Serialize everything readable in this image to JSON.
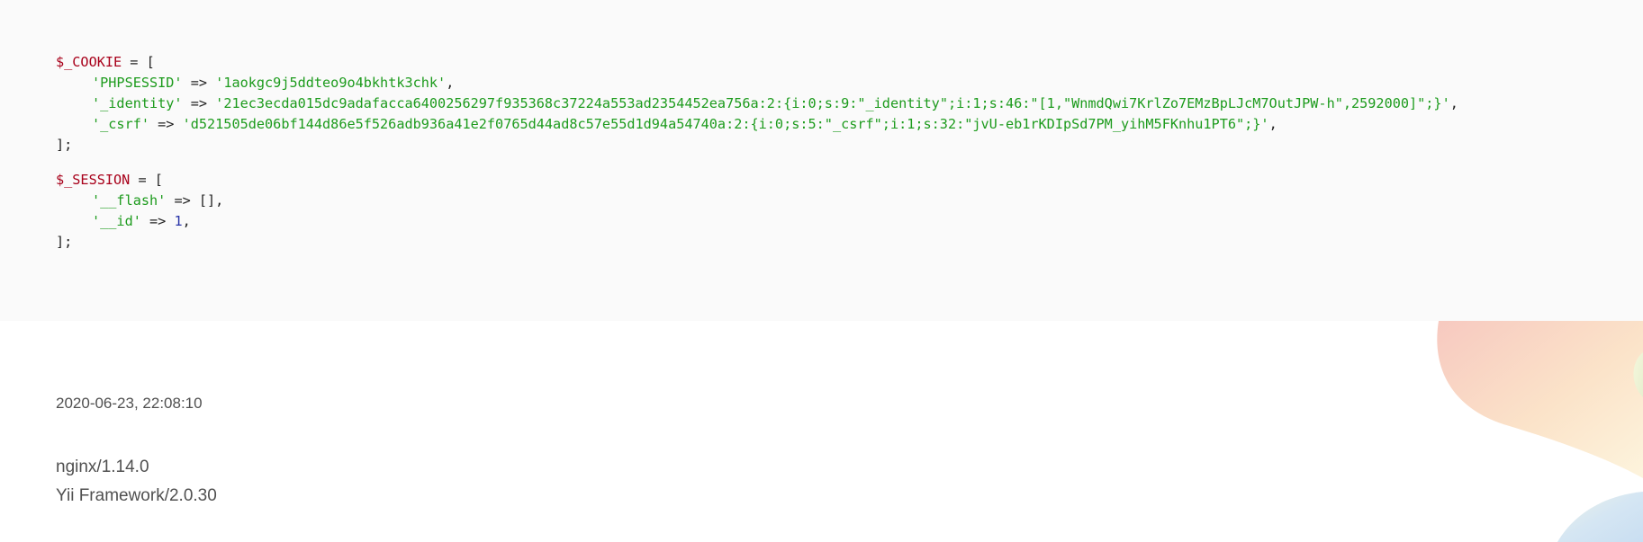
{
  "cookie_block": {
    "open_var": "$_COOKIE",
    "open_rest": " = [",
    "entries": [
      {
        "key": "'PHPSESSID'",
        "arrow": " => ",
        "value": "'1aokgc9j5ddteo9o4bkhtk3chk'",
        "tail": ","
      },
      {
        "key": "'_identity'",
        "arrow": " => ",
        "value": "'21ec3ecda015dc9adafacca6400256297f935368c37224a553ad2354452ea756a:2:{i:0;s:9:\"_identity\";i:1;s:46:\"[1,\"WnmdQwi7KrlZo7EMzBpLJcM7OutJPW-h\",2592000]\";}'",
        "tail": ","
      },
      {
        "key": "'_csrf'",
        "arrow": " => ",
        "value": "'d521505de06bf144d86e5f526adb936a41e2f0765d44ad8c57e55d1d94a54740a:2:{i:0;s:5:\"_csrf\";i:1;s:32:\"jvU-eb1rKDIpSd7PM_yihM5FKnhu1PT6\";}'",
        "tail": ","
      }
    ],
    "close": "];"
  },
  "session_block": {
    "open_var": "$_SESSION",
    "open_rest": " = [",
    "flash": {
      "key": "'__flash'",
      "rest": " => [],"
    },
    "id": {
      "key": "'__id'",
      "arrow": " => ",
      "value": "1",
      "tail": ","
    },
    "close": "];"
  },
  "footer": {
    "timestamp": "2020-06-23, 22:08:10",
    "server": "nginx/1.14.0",
    "framework": "Yii Framework/2.0.30"
  },
  "colors": {
    "variable": "#a8001a",
    "string": "#1d9b1d",
    "number": "#2934a8",
    "panel_background": "#fafafa"
  }
}
